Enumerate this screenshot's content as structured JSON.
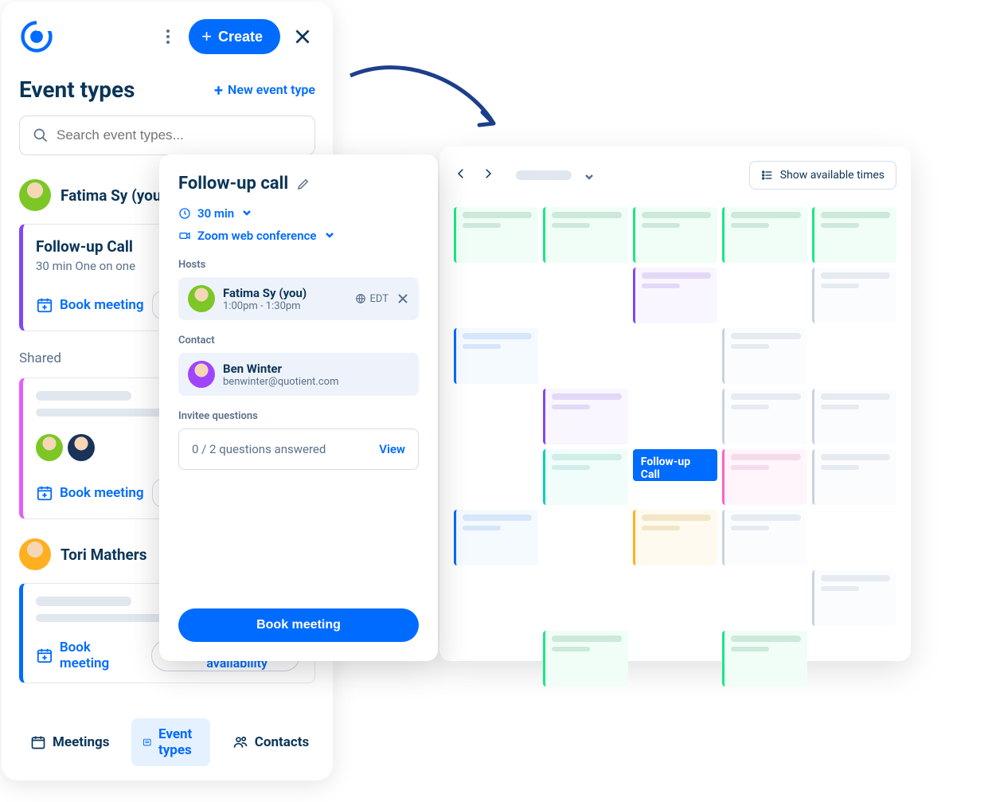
{
  "left": {
    "create_label": "Create",
    "title": "Event types",
    "new_event_label": "New event type",
    "search_placeholder": "Search event types...",
    "user1_name": "Fatima Sy (you)",
    "card1_title": "Follow-up Call",
    "card1_sub": "30 min   One on one",
    "book_meeting": "Book meeting",
    "shared_label": "Shared",
    "user3_name": "Tori Mathers",
    "share_availability": "Share availability",
    "tab_meetings": "Meetings",
    "tab_event_types": "Event types",
    "tab_contacts": "Contacts"
  },
  "pop": {
    "title": "Follow-up call",
    "duration": "30 min",
    "location": "Zoom web conference",
    "hosts_label": "Hosts",
    "host_name": "Fatima Sy (you)",
    "host_time": "1:00pm - 1:30pm",
    "host_tz": "EDT",
    "contact_label": "Contact",
    "contact_name": "Ben Winter",
    "contact_email": "benwinter@quotient.com",
    "questions_label": "Invitee questions",
    "questions_summary": "0 / 2 questions answered",
    "view_label": "View",
    "book_label": "Book meeting"
  },
  "cal": {
    "show_available": "Show available times",
    "event_label": "Follow-up Call"
  }
}
